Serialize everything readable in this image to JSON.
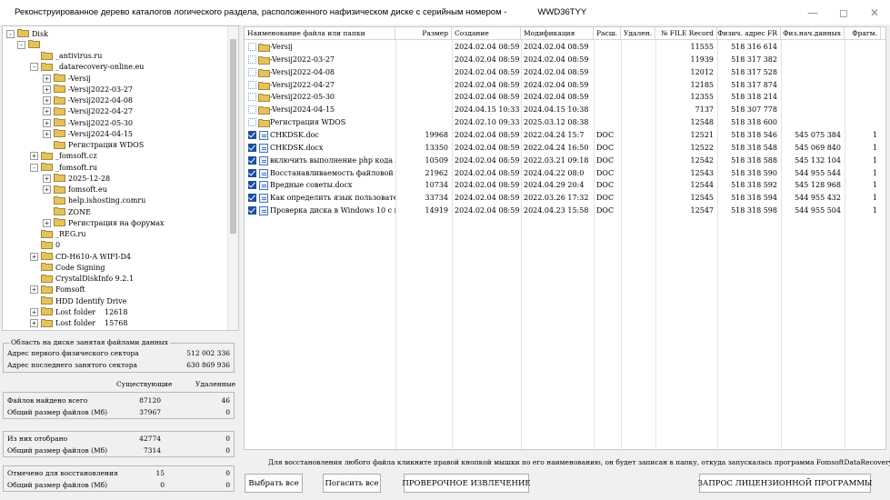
{
  "window": {
    "title": "Реконструированное дерево каталогов логического раздела, расположенного нафизическом диске с серийным номером -",
    "serial": "WWD36TYY",
    "minimize_icon": "minimize-icon",
    "maximize_icon": "maximize-icon",
    "close_icon": "close-icon"
  },
  "tree": {
    "nodes": [
      {
        "label": "Disk",
        "exp": "-",
        "depth": 0
      },
      {
        "label": "",
        "exp": "-",
        "depth": 1
      },
      {
        "label": "_antivirus.ru",
        "exp": "",
        "depth": 2
      },
      {
        "label": "_datarecovery-online.eu",
        "exp": "-",
        "depth": 2
      },
      {
        "label": "-Versij",
        "exp": "+",
        "depth": 3
      },
      {
        "label": "-Versij2022-03-27",
        "exp": "+",
        "depth": 3
      },
      {
        "label": "-Versij2022-04-08",
        "exp": "+",
        "depth": 3
      },
      {
        "label": "-Versij2022-04-27",
        "exp": "+",
        "depth": 3
      },
      {
        "label": "-Versij2022-05-30",
        "exp": "+",
        "depth": 3
      },
      {
        "label": "-Versij2024-04-15",
        "exp": "+",
        "depth": 3
      },
      {
        "label": "Регистрация WDOS",
        "exp": "",
        "depth": 3
      },
      {
        "label": "_fomsoft.cz",
        "exp": "+",
        "depth": 2
      },
      {
        "label": "_fomsoft.ru",
        "exp": "-",
        "depth": 2
      },
      {
        "label": "2025-12-28",
        "exp": "+",
        "depth": 3
      },
      {
        "label": "fomsoft.eu",
        "exp": "+",
        "depth": 3
      },
      {
        "label": "help.ishosting.comru",
        "exp": "",
        "depth": 3
      },
      {
        "label": "ZONE",
        "exp": "",
        "depth": 3
      },
      {
        "label": "Регистрация на форумах",
        "exp": "+",
        "depth": 3
      },
      {
        "label": "_REG.ru",
        "exp": "",
        "depth": 2
      },
      {
        "label": "0",
        "exp": "",
        "depth": 2
      },
      {
        "label": "CD-H610-A WIFI-D4",
        "exp": "+",
        "depth": 2
      },
      {
        "label": "Code Signing",
        "exp": "",
        "depth": 2
      },
      {
        "label": "CrystalDiskInfo 9.2.1",
        "exp": "",
        "depth": 2
      },
      {
        "label": "Fomsoft",
        "exp": "+",
        "depth": 2
      },
      {
        "label": "HDD Identify Drive",
        "exp": "",
        "depth": 2
      },
      {
        "label": "Lost folder",
        "exp": "+",
        "depth": 2,
        "num": "12618"
      },
      {
        "label": "Lost folder",
        "exp": "+",
        "depth": 2,
        "num": "15768"
      }
    ]
  },
  "stats": {
    "area_legend": "Область на диске занятая файлами данных",
    "first_sector_label": "Адрес первого физического сектора",
    "first_sector_value": "512 002 336",
    "last_sector_label": "Адрес последнего занятого сектора",
    "last_sector_value": "630 869 936",
    "col_existing": "Существующие",
    "col_deleted": "Удаленные",
    "found_label": "Файлов найдено всего",
    "found_existing": "87120",
    "found_deleted": "46",
    "size_label": "Общий размер файлов (Мб)",
    "size_existing": "37967",
    "size_deleted": "0",
    "selected_label": "Из них отобрано",
    "selected_existing": "42774",
    "selected_deleted": "0",
    "selected_size_label": "Общий размер файлов (Мб)",
    "selected_size_existing": "7314",
    "selected_size_deleted": "0",
    "marked_label": "Отмечено для восстановления",
    "marked_existing": "15",
    "marked_deleted": "0",
    "marked_size_label": "Общий размер файлов (Мб)",
    "marked_size_existing": "0",
    "marked_size_deleted": "0"
  },
  "filelist": {
    "headers": [
      "Наименование файла или папки",
      "Размер",
      "Создание",
      "Модификация",
      "Расш.",
      "Удален.",
      "№ FILE Record",
      "Физич. адрес FR",
      "Физ.нач.данных",
      "Фрагм."
    ],
    "rows": [
      {
        "checked": false,
        "folder": true,
        "name": "-Versij",
        "size": "",
        "created": "2024.02.04 08:59",
        "modified": "2024.02.04 08:59",
        "ext": "",
        "deleted": "",
        "record": "11555",
        "fr_addr": "518 316 614",
        "data_addr": "",
        "frag": ""
      },
      {
        "checked": false,
        "folder": true,
        "name": "-Versij2022-03-27",
        "size": "",
        "created": "2024.02.04 08:59",
        "modified": "2024.02.04 08:59",
        "ext": "",
        "deleted": "",
        "record": "11939",
        "fr_addr": "518 317 382",
        "data_addr": "",
        "frag": ""
      },
      {
        "checked": false,
        "folder": true,
        "name": "-Versij2022-04-08",
        "size": "",
        "created": "2024.02.04 08:59",
        "modified": "2024.02.04 08:59",
        "ext": "",
        "deleted": "",
        "record": "12012",
        "fr_addr": "518 317 528",
        "data_addr": "",
        "frag": ""
      },
      {
        "checked": false,
        "folder": true,
        "name": "-Versij2022-04-27",
        "size": "",
        "created": "2024.02.04 08:59",
        "modified": "2024.02.04 08:59",
        "ext": "",
        "deleted": "",
        "record": "12185",
        "fr_addr": "518 317 874",
        "data_addr": "",
        "frag": ""
      },
      {
        "checked": false,
        "folder": true,
        "name": "-Versij2022-05-30",
        "size": "",
        "created": "2024.02.04 08:59",
        "modified": "2024.02.04 08:59",
        "ext": "",
        "deleted": "",
        "record": "12355",
        "fr_addr": "518 318 214",
        "data_addr": "",
        "frag": ""
      },
      {
        "checked": false,
        "folder": true,
        "name": "-Versij2024-04-15",
        "size": "",
        "created": "2024.04.15 10:33",
        "modified": "2024.04.15 10:38",
        "ext": "",
        "deleted": "",
        "record": "7137",
        "fr_addr": "518 307 778",
        "data_addr": "",
        "frag": ""
      },
      {
        "checked": false,
        "folder": true,
        "name": "Регистрация WDOS",
        "size": "",
        "created": "2024.02.10 09:33",
        "modified": "2025.03.12 08:38",
        "ext": "",
        "deleted": "",
        "record": "12548",
        "fr_addr": "518 318 600",
        "data_addr": "",
        "frag": ""
      },
      {
        "checked": true,
        "folder": false,
        "name": "CHKDSK.doc",
        "size": "19968",
        "created": "2024.02.04 08:59",
        "modified": "2022.04.24 15:7",
        "ext": "DOC",
        "deleted": "",
        "record": "12521",
        "fr_addr": "518 318 546",
        "data_addr": "545 075 384",
        "frag": "1"
      },
      {
        "checked": true,
        "folder": false,
        "name": "CHKDSK.docx",
        "size": "13350",
        "created": "2024.02.04 08:59",
        "modified": "2022.04.24 16:50",
        "ext": "DOC",
        "deleted": "",
        "record": "12522",
        "fr_addr": "518 318 548",
        "data_addr": "545 069 840",
        "frag": "1"
      },
      {
        "checked": true,
        "folder": false,
        "name": "включить выполнение php кода в h...",
        "size": "10509",
        "created": "2024.02.04 08:59",
        "modified": "2022.03.21 09:18",
        "ext": "DOC",
        "deleted": "",
        "record": "12542",
        "fr_addr": "518 318 588",
        "data_addr": "545 132 104",
        "frag": "1"
      },
      {
        "checked": true,
        "folder": false,
        "name": "Восстанавливаемость файловой си...",
        "size": "21962",
        "created": "2024.02.04 08:59",
        "modified": "2024.04.22 08:0",
        "ext": "DOC",
        "deleted": "",
        "record": "12543",
        "fr_addr": "518 318 590",
        "data_addr": "544 955 544",
        "frag": "1"
      },
      {
        "checked": true,
        "folder": false,
        "name": "Вредные советы.docx",
        "size": "10734",
        "created": "2024.02.04 08:59",
        "modified": "2024.04.29 20:4",
        "ext": "DOC",
        "deleted": "",
        "record": "12544",
        "fr_addr": "518 318 592",
        "data_addr": "545 128 968",
        "frag": "1"
      },
      {
        "checked": true,
        "folder": false,
        "name": "Как определить язык пользователя ...",
        "size": "33734",
        "created": "2024.02.04 08:59",
        "modified": "2022.03.26 17:32",
        "ext": "DOC",
        "deleted": "",
        "record": "12545",
        "fr_addr": "518 318 594",
        "data_addr": "544 955 432",
        "frag": "1"
      },
      {
        "checked": true,
        "folder": false,
        "name": "Проверка диска в Windows 10 с по...",
        "size": "14919",
        "created": "2024.02.04 08:59",
        "modified": "2024.04.23 15:58",
        "ext": "DOC",
        "deleted": "",
        "record": "12547",
        "fr_addr": "518 318 598",
        "data_addr": "544 955 504",
        "frag": "1"
      }
    ]
  },
  "hint": "Для восстановления любого файла кликните правой кнопкой мышки по его наименованию, он будет записан в папку, откуда запускалась программа FomsoftDataRecovery.",
  "buttons": {
    "select_all": "Выбрать все",
    "clear_all": "Погасить все",
    "test_extract": "ПРОВЕРОЧНОЕ ИЗВЛЕЧЕНИЕ",
    "license_request": "ЗАПРОС ЛИЦЕНЗИОННОЙ ПРОГРАММЫ"
  },
  "colors": {
    "folder": "#e6c25a",
    "checkbox": "#1d4fa0"
  }
}
